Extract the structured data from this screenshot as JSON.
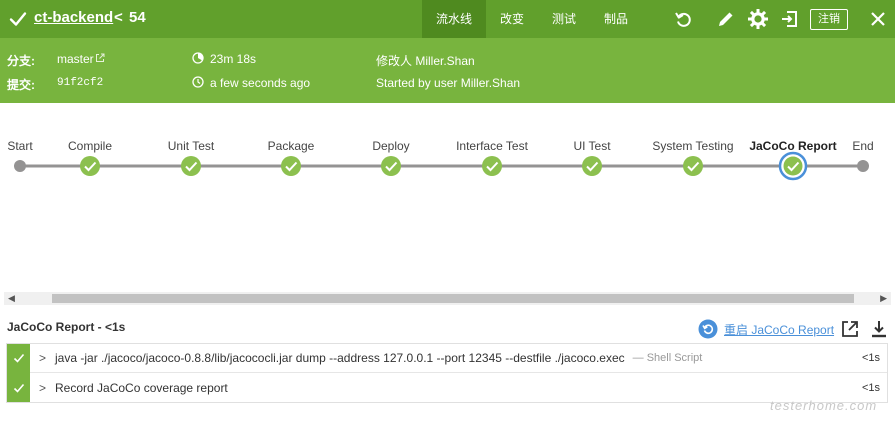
{
  "header": {
    "job_name": "ct-backend",
    "chevron": "<",
    "run_number": "54",
    "tabs": [
      {
        "label": "流水线",
        "active": true
      },
      {
        "label": "改变",
        "active": false
      },
      {
        "label": "测试",
        "active": false
      },
      {
        "label": "制品",
        "active": false
      }
    ],
    "icons": [
      "rerun-icon",
      "edit-icon",
      "settings-icon",
      "exit-icon",
      "close-icon"
    ],
    "logout_label": "注销"
  },
  "info": {
    "branch_label": "分支:",
    "branch_value": "master",
    "commit_label": "提交:",
    "commit_value": "91f2cf2",
    "duration": "23m 18s",
    "time_ago": "a few seconds ago",
    "changes_by": "修改人 Miller.Shan",
    "started_by": "Started by user Miller.Shan"
  },
  "pipeline": {
    "stages": [
      {
        "label": "Start",
        "kind": "start"
      },
      {
        "label": "Compile",
        "kind": "success"
      },
      {
        "label": "Unit Test",
        "kind": "success"
      },
      {
        "label": "Package",
        "kind": "success"
      },
      {
        "label": "Deploy",
        "kind": "success"
      },
      {
        "label": "Interface Test",
        "kind": "success"
      },
      {
        "label": "UI Test",
        "kind": "success"
      },
      {
        "label": "System Testing",
        "kind": "success"
      },
      {
        "label": "JaCoCo Report",
        "kind": "selected"
      },
      {
        "label": "End",
        "kind": "end"
      }
    ]
  },
  "log": {
    "title": "JaCoCo Report - <1s",
    "restart_label": "重启 JaCoCo Report",
    "steps": [
      {
        "command": "java -jar ./jacoco/jacoco-0.8.8/lib/jacococli.jar dump --address 127.0.0.1 --port 12345 --destfile ./jacoco.exec",
        "type": "— Shell Script",
        "duration": "<1s"
      },
      {
        "command": "Record JaCoCo coverage report",
        "type": "",
        "duration": "<1s"
      }
    ]
  },
  "watermark": "testerhome.com",
  "colors": {
    "header_green": "#61a02c",
    "info_green": "#78b43e",
    "success_green": "#8cc04f",
    "selected_ring": "#4a90d9",
    "node_grey": "#949393"
  }
}
